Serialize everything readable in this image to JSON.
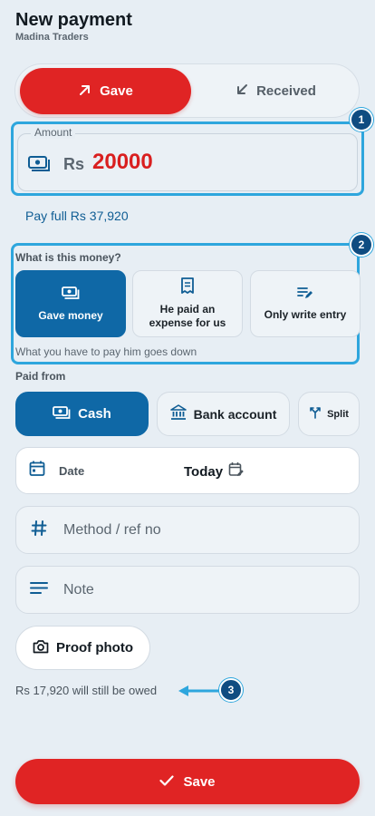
{
  "header": {
    "title": "New payment",
    "subtitle": "Madina Traders"
  },
  "direction_toggle": {
    "gave_label": "Gave",
    "received_label": "Received",
    "selected": "gave"
  },
  "amount": {
    "label": "Amount",
    "currency": "Rs",
    "value": "20000"
  },
  "pay_full_link": "Pay full Rs 37,920",
  "purpose": {
    "question": "What is this money?",
    "options": [
      {
        "label": "Gave money",
        "icon": "banknote-icon",
        "selected": true
      },
      {
        "label": "He paid an expense for us",
        "icon": "receipt-icon",
        "selected": false
      },
      {
        "label": "Only write entry",
        "icon": "edit-list-icon",
        "selected": false
      }
    ],
    "hint": "What you have to pay him goes down"
  },
  "paid_from": {
    "label": "Paid from",
    "options": [
      {
        "label": "Cash",
        "icon": "cash-icon",
        "selected": true
      },
      {
        "label": "Bank account",
        "icon": "bank-icon",
        "selected": false
      },
      {
        "label": "Split",
        "icon": "split-icon",
        "selected": false
      }
    ]
  },
  "date": {
    "label": "Date",
    "value": "Today"
  },
  "method": {
    "placeholder": "Method / ref no"
  },
  "note": {
    "placeholder": "Note"
  },
  "proof_photo": {
    "label": "Proof photo"
  },
  "owed_text": "Rs 17,920 will still be owed",
  "save_label": "Save",
  "annotations": [
    "1",
    "2",
    "3"
  ],
  "colors": {
    "accent_red": "#e02424",
    "primary_blue": "#0f68a6",
    "highlight": "#2ea6dd",
    "marker": "#0f4c81"
  }
}
